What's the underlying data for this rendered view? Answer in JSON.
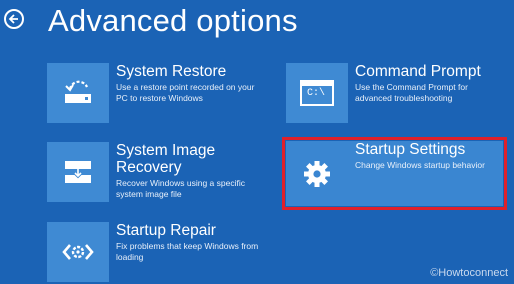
{
  "header": {
    "title": "Advanced options"
  },
  "tiles": [
    {
      "title": "System Restore",
      "desc": "Use a restore point recorded on your PC to restore Windows",
      "icon": "system-restore-icon"
    },
    {
      "title": "System Image Recovery",
      "desc": "Recover Windows using a specific system image file",
      "icon": "system-image-icon"
    },
    {
      "title": "Startup Repair",
      "desc": "Fix problems that keep Windows from loading",
      "icon": "startup-repair-icon"
    },
    {
      "title": "Command Prompt",
      "desc": "Use the Command Prompt for advanced troubleshooting",
      "icon": "command-prompt-icon",
      "icon_text": "C:\\"
    },
    {
      "title": "Startup Settings",
      "desc": "Change Windows startup behavior",
      "icon": "gear-icon"
    }
  ],
  "watermark": "©Howtoconnect",
  "colors": {
    "background": "#1b63b5",
    "tile_icon": "#3f8ad3",
    "highlight": "#e0202a"
  }
}
